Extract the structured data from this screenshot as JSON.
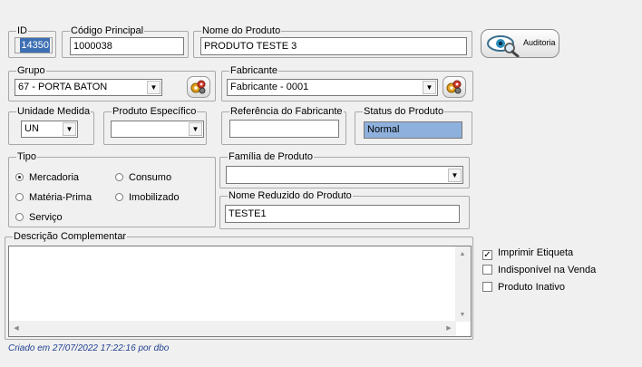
{
  "id": {
    "label": "ID",
    "value": "14350"
  },
  "codigo_principal": {
    "label": "Código Principal",
    "value": "1000038"
  },
  "nome_produto": {
    "label": "Nome do Produto",
    "value": "PRODUTO TESTE 3"
  },
  "auditoria": {
    "label": "Auditoria"
  },
  "grupo": {
    "label": "Grupo",
    "value": "67 - PORTA BATON"
  },
  "fabricante": {
    "label": "Fabricante",
    "value": "Fabricante - 0001"
  },
  "unidade_medida": {
    "label": "Unidade Medida",
    "value": "UN"
  },
  "produto_especifico": {
    "label": "Produto Específico",
    "value": ""
  },
  "referencia_fabricante": {
    "label": "Referência do Fabricante",
    "value": ""
  },
  "status_produto": {
    "label": "Status do Produto",
    "value": "Normal"
  },
  "tipo": {
    "label": "Tipo",
    "options": [
      "Mercadoria",
      "Consumo",
      "Matéria-Prima",
      "Imobilizado",
      "Serviço"
    ],
    "selected": "Mercadoria"
  },
  "familia_produto": {
    "label": "Família de Produto",
    "value": ""
  },
  "nome_reduzido": {
    "label": "Nome Reduzido do Produto",
    "value": "TESTE1"
  },
  "descricao_complementar": {
    "label": "Descrição Complementar",
    "value": ""
  },
  "checkboxes": [
    {
      "label": "Imprimir Etiqueta",
      "checked": true
    },
    {
      "label": "Indisponível na Venda",
      "checked": false
    },
    {
      "label": "Produto Inativo",
      "checked": false
    }
  ],
  "footer": {
    "created": "Criado em 27/07/2022 17:22:16 por dbo"
  },
  "colors": {
    "selection": "#3d6fb3",
    "status_bg": "#8eb0dc",
    "footer_text": "#1f3f8f"
  },
  "icons": {
    "auditoria": "eye-magnifier-icon",
    "lookup": "lookup-gears-icon",
    "dropdown": "chevron-down-icon"
  }
}
